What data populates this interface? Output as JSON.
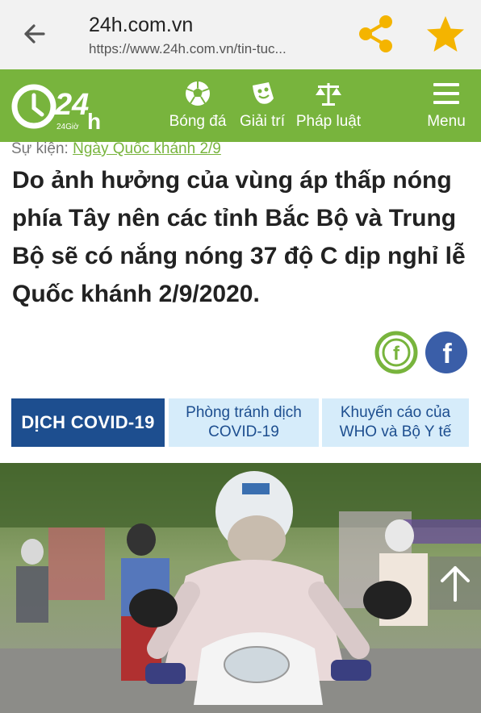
{
  "browser": {
    "domain": "24h.com.vn",
    "url": "https://www.24h.com.vn/tin-tuc..."
  },
  "header": {
    "nav": [
      {
        "label": "Bóng đá",
        "icon": "football-icon"
      },
      {
        "label": "Giải trí",
        "icon": "entertainment-icon"
      },
      {
        "label": "Pháp luật",
        "icon": "scales-icon"
      },
      {
        "label": "Menu",
        "icon": "hamburger-icon"
      }
    ],
    "brand_color": "#78b43d"
  },
  "article": {
    "event_label": "Sự kiện:",
    "event_link": "Ngày Quốc khánh 2/9",
    "headline": "Do ảnh hưởng của vùng áp thấp nóng phía Tây nên các tỉnh Bắc Bộ và Trung Bộ sẽ có nắng nóng 37 độ C dịp nghỉ lễ Quốc khánh 2/9/2020."
  },
  "covid": {
    "main": "DỊCH COVID-19",
    "tab1_line1": "Phòng tránh dịch",
    "tab1_line2": "COVID-19",
    "tab2_line1": "Khuyến cáo của",
    "tab2_line2": "WHO và Bộ Y tế",
    "main_color": "#1d4e8f",
    "tab_color": "#d6ecfa"
  },
  "icons": {
    "share": "share-icon",
    "star": "star-icon",
    "back": "back-arrow-icon",
    "scroll_top": "arrow-up-icon"
  }
}
